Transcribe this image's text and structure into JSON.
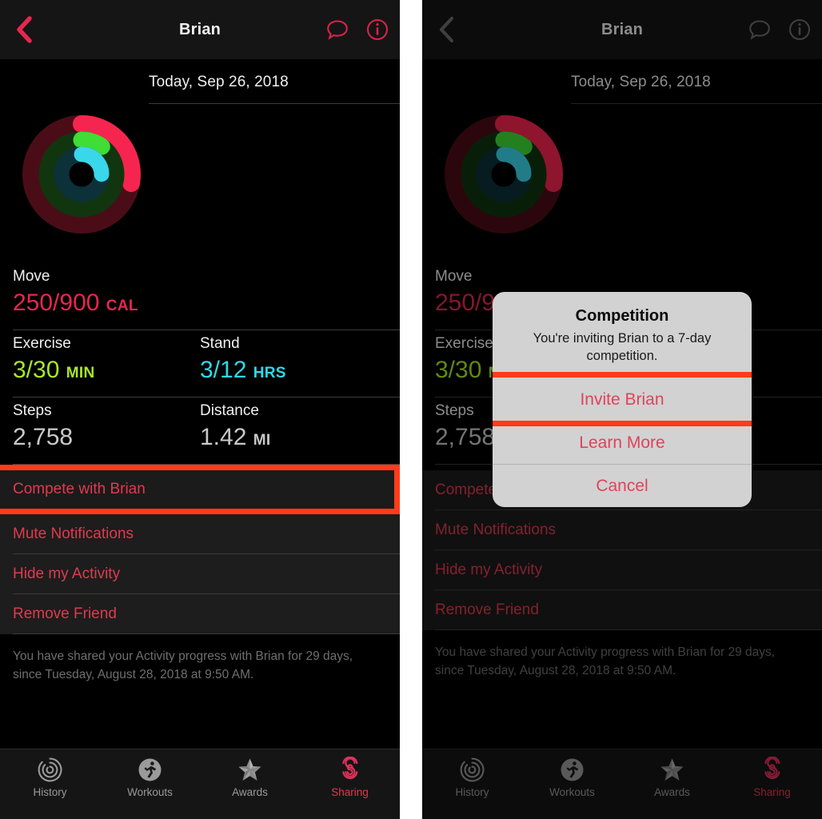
{
  "colors": {
    "move": "#e8264f",
    "exercise": "#a8e82a",
    "stand": "#2fd9e8",
    "accent_red": "#e03a4e",
    "highlight": "#ff3b1a",
    "screen_bg": "#000000",
    "navbar_bg": "#151515",
    "dialog_bg": "#d2d2d2",
    "dialog_text": "#e0435a"
  },
  "navbar": {
    "title": "Brian",
    "back_icon": "chevron-left-icon",
    "message_icon": "message-bubble-icon",
    "info_icon": "info-circle-icon"
  },
  "date": {
    "text": "Today, Sep 26, 2018"
  },
  "rings": {
    "move": {
      "label": "Move",
      "progress": 0.278
    },
    "exercise": {
      "label": "Exercise",
      "progress": 0.1
    },
    "stand": {
      "label": "Stand",
      "progress": 0.25
    }
  },
  "stats": [
    {
      "cells": [
        {
          "label": "Move",
          "value": "250/900",
          "unit": "CAL",
          "color_key": "move"
        }
      ]
    },
    {
      "cells": [
        {
          "label": "Exercise",
          "value": "3/30",
          "unit": "MIN",
          "color_key": "exercise"
        },
        {
          "label": "Stand",
          "value": "3/12",
          "unit": "HRS",
          "color_key": "stand"
        }
      ]
    },
    {
      "cells": [
        {
          "label": "Steps",
          "value": "2,758",
          "unit": "",
          "color_key": "neutral"
        },
        {
          "label": "Distance",
          "value": "1.42",
          "unit": "MI",
          "color_key": "neutral"
        }
      ]
    }
  ],
  "actions": [
    {
      "label": "Compete with Brian",
      "highlighted": true
    },
    {
      "label": "Mute Notifications",
      "highlighted": false
    },
    {
      "label": "Hide my Activity",
      "highlighted": false
    },
    {
      "label": "Remove Friend",
      "highlighted": false
    }
  ],
  "footnote": {
    "line1": "You have shared your Activity progress with Brian for 29 days,",
    "line2": "since Tuesday, August 28, 2018 at 9:50 AM."
  },
  "tabs": [
    {
      "label": "History",
      "icon": "history-rings-icon",
      "active": false
    },
    {
      "label": "Workouts",
      "icon": "workouts-runner-icon",
      "active": false
    },
    {
      "label": "Awards",
      "icon": "awards-star-icon",
      "active": false
    },
    {
      "label": "Sharing",
      "icon": "sharing-s-icon",
      "active": true
    }
  ],
  "alert": {
    "title": "Competition",
    "message": "You're inviting Brian to a 7-day competition.",
    "buttons": [
      {
        "label": "Invite Brian",
        "highlighted": true
      },
      {
        "label": "Learn More",
        "highlighted": false
      },
      {
        "label": "Cancel",
        "highlighted": false
      }
    ]
  }
}
